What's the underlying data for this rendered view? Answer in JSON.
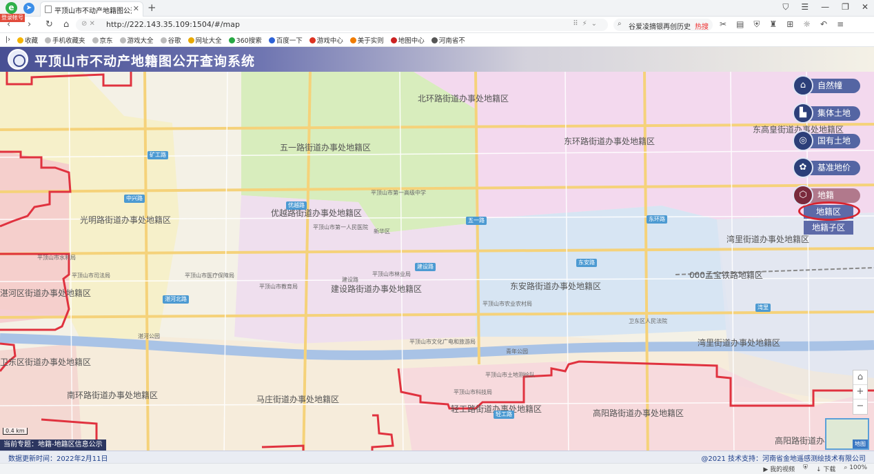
{
  "browser": {
    "login_badge": "登录帐号",
    "tab_title": "平顶山市不动产地籍图公开查询系统",
    "url": "http://222.143.35.109:1504/#/map",
    "search_text": "谷爱凌摘银再创历史",
    "search_hot": "热搜",
    "bookmarks": [
      "收藏",
      "手机收藏夹",
      "京东",
      "游戏大全",
      "谷歌",
      "网址大全",
      "360搜索",
      "百度一下",
      "游戏中心",
      "美于实则",
      "地图中心",
      "河南省不"
    ],
    "status_items": [
      "我的视频",
      "下载",
      "100%"
    ]
  },
  "app": {
    "title": "平顶山市不动产地籍图公开查询系统",
    "theme_label": "当前专题：地籍-地籍区信息公示",
    "scale": "0.4 km",
    "update_time": "数据更新时间：2022年2月11日",
    "tech_support": "@2021 技术支持：河南省金地遥感测绘技术有限公司",
    "minimap_label": "地图"
  },
  "layers": [
    {
      "label": "自然幢",
      "icon": "house-icon"
    },
    {
      "label": "集体土地",
      "icon": "buildings-icon"
    },
    {
      "label": "国有土地",
      "icon": "seal-icon"
    },
    {
      "label": "基准地价",
      "icon": "china-map-icon"
    },
    {
      "label": "地籍",
      "icon": "cube-icon"
    }
  ],
  "sub_layers": [
    "地籍区",
    "地籍子区"
  ],
  "districts": [
    "北环路街道办事处地籍区",
    "东环路街道办事处地籍区",
    "东高皇街道办事处地籍区",
    "五一路街道办事处地籍区",
    "光明路街道办事处地籍区",
    "优越路街道办事处地籍区",
    "湾里街道办事处地籍区",
    "建设路街道办事处地籍区",
    "东安路街道办事处地籍区",
    "000孟宝铁路地籍区",
    "湛河区街道办事处地籍区",
    "卫东区街道办事处地籍区",
    "南环路街道办事处地籍区",
    "马庄街道办事处地籍区",
    "轻工路街道办事处地籍区",
    "高阳路街道办事处地籍区",
    "湾里街道办事处地籍区",
    "高阳路街道办事处地籍区"
  ],
  "road_badges": [
    "矿工路",
    "中兴路",
    "优越路",
    "五一路",
    "东环路",
    "建设路",
    "东安路",
    "湛河北路",
    "湾里",
    "轻工路"
  ],
  "pois": [
    "平顶山市第一高级中学",
    "平顶山市第一人民医院",
    "平顶山市教育局",
    "平顶山市文化广电和旅游局",
    "平顶山市林业局",
    "平顶山市司法局",
    "平顶山市水利局",
    "平顶山市医疗保障局",
    "卫东区人民法院",
    "新华区",
    "建设路",
    "青年公园",
    "湛河公园",
    "平顶山市农业农村局",
    "平顶山市科技局",
    "平顶山市土地测绘队"
  ]
}
